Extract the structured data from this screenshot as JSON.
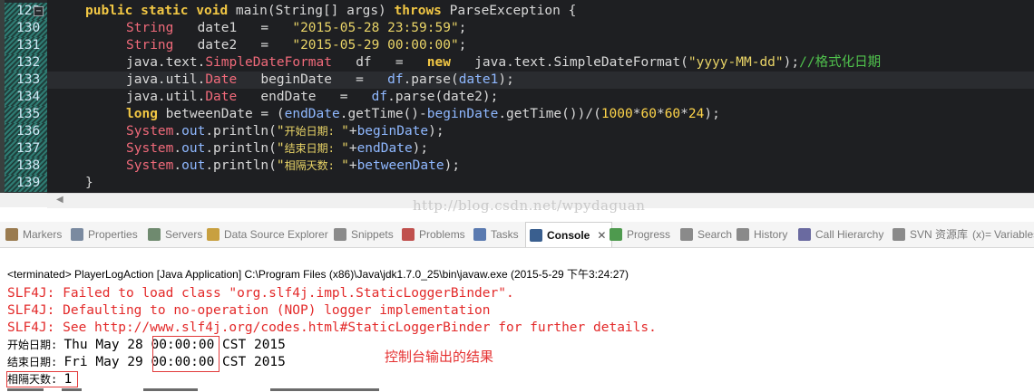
{
  "editor": {
    "line_numbers": [
      "129",
      "130",
      "131",
      "132",
      "133",
      "134",
      "135",
      "136",
      "137",
      "138",
      "139"
    ],
    "lines": [
      [
        [
          "kw",
          "public"
        ],
        [
          "p",
          " "
        ],
        [
          "kw",
          "static"
        ],
        [
          "p",
          " "
        ],
        [
          "kw",
          "void"
        ],
        [
          "p",
          " main("
        ],
        [
          "p",
          "String"
        ],
        [
          "p",
          "[] args) "
        ],
        [
          "kw",
          "throws"
        ],
        [
          "p",
          " ParseException {"
        ]
      ],
      [
        [
          "ty",
          "String"
        ],
        [
          "p",
          "   date1   =   "
        ],
        [
          "str",
          "\"2015-05-28 23:59:59\""
        ],
        [
          "p",
          ";"
        ]
      ],
      [
        [
          "ty",
          "String"
        ],
        [
          "p",
          "   date2   =   "
        ],
        [
          "str",
          "\"2015-05-29 00:00:00\""
        ],
        [
          "p",
          ";"
        ]
      ],
      [
        [
          "p",
          "java.text."
        ],
        [
          "ty",
          "SimpleDateFormat"
        ],
        [
          "p",
          "   df   =   "
        ],
        [
          "kw",
          "new"
        ],
        [
          "p",
          "   java.text.SimpleDateFormat("
        ],
        [
          "str",
          "\"yyyy-MM-dd\""
        ],
        [
          "p",
          ");"
        ],
        [
          "cmt",
          "//格式化日期"
        ]
      ],
      [
        [
          "p",
          "java.util."
        ],
        [
          "ty",
          "Date"
        ],
        [
          "p",
          "   beginDate   =   "
        ],
        [
          "fld",
          "df"
        ],
        [
          "p",
          ".parse("
        ],
        [
          "fld",
          "date1"
        ],
        [
          "p",
          ");"
        ]
      ],
      [
        [
          "p",
          "java.util."
        ],
        [
          "ty",
          "Date"
        ],
        [
          "p",
          "   endDate   =   "
        ],
        [
          "fld",
          "df"
        ],
        [
          "p",
          ".parse(date2);"
        ]
      ],
      [
        [
          "kw",
          "long"
        ],
        [
          "p",
          " betweenDate = ("
        ],
        [
          "fld",
          "endDate"
        ],
        [
          "p",
          ".getTime()-"
        ],
        [
          "fld",
          "beginDate"
        ],
        [
          "p",
          ".getTime())/("
        ],
        [
          "num",
          "1000"
        ],
        [
          "p",
          "*"
        ],
        [
          "num",
          "60"
        ],
        [
          "p",
          "*"
        ],
        [
          "num",
          "60"
        ],
        [
          "p",
          "*"
        ],
        [
          "num",
          "24"
        ],
        [
          "p",
          ");"
        ]
      ],
      [
        [
          "ty",
          "System"
        ],
        [
          "p",
          "."
        ],
        [
          "fld",
          "out"
        ],
        [
          "p",
          ".println("
        ],
        [
          "str",
          "\""
        ],
        [
          "strcjk",
          "开始日期: "
        ],
        [
          "str",
          "\""
        ],
        [
          "p",
          "+"
        ],
        [
          "fld",
          "beginDate"
        ],
        [
          "p",
          ");"
        ]
      ],
      [
        [
          "ty",
          "System"
        ],
        [
          "p",
          "."
        ],
        [
          "fld",
          "out"
        ],
        [
          "p",
          ".println("
        ],
        [
          "str",
          "\""
        ],
        [
          "strcjk",
          "结束日期: "
        ],
        [
          "str",
          "\""
        ],
        [
          "p",
          "+"
        ],
        [
          "fld",
          "endDate"
        ],
        [
          "p",
          ");"
        ]
      ],
      [
        [
          "ty",
          "System"
        ],
        [
          "p",
          "."
        ],
        [
          "fld",
          "out"
        ],
        [
          "p",
          ".println("
        ],
        [
          "str",
          "\""
        ],
        [
          "strcjk",
          "相隔天数: "
        ],
        [
          "str",
          "\""
        ],
        [
          "p",
          "+"
        ],
        [
          "fld",
          "betweenDate"
        ],
        [
          "p",
          ");"
        ]
      ],
      [
        [
          "p",
          "}"
        ]
      ]
    ],
    "indent_levels": [
      0,
      1,
      1,
      1,
      1,
      1,
      1,
      1,
      1,
      1,
      0
    ],
    "current_line_index": 4,
    "watermark": "http://blog.csdn.net/wpydaguan"
  },
  "tabs": [
    {
      "label": "Markers",
      "icon": "markers-icon",
      "color": "#9a7b4f"
    },
    {
      "label": "Properties",
      "icon": "properties-icon",
      "color": "#7a8aa0"
    },
    {
      "label": "Servers",
      "icon": "servers-icon",
      "color": "#6f8a6f"
    },
    {
      "label": "Data Source Explorer",
      "icon": "data-source-icon",
      "color": "#c8a040"
    },
    {
      "label": "Snippets",
      "icon": "snippets-icon",
      "color": "#8a8a8a"
    },
    {
      "label": "Problems",
      "icon": "problems-icon",
      "color": "#c0504d"
    },
    {
      "label": "Tasks",
      "icon": "tasks-icon",
      "color": "#5a7ab0"
    },
    {
      "label": "Console",
      "icon": "console-icon",
      "color": "#3a5f8f",
      "active": true
    },
    {
      "label": "Progress",
      "icon": "progress-icon",
      "color": "#4e9a4e"
    },
    {
      "label": "Search",
      "icon": "search-icon",
      "color": "#8a8a8a"
    },
    {
      "label": "History",
      "icon": "history-icon",
      "color": "#8a8a8a"
    },
    {
      "label": "Call Hierarchy",
      "icon": "call-hierarchy-icon",
      "color": "#6a6aa0"
    },
    {
      "label": "SVN 资源库",
      "icon": "svn-icon",
      "color": "#8a8a8a"
    },
    {
      "label": "Variables",
      "icon": "variables-icon",
      "color": "#8a8a8a",
      "prefix": "(x)="
    }
  ],
  "console": {
    "terminated": "<terminated> PlayerLogAction [Java Application] C:\\Program Files (x86)\\Java\\jdk1.7.0_25\\bin\\javaw.exe (2015-5-29 下午3:24:27)",
    "err_lines": [
      "SLF4J: Failed to load class \"org.slf4j.impl.StaticLoggerBinder\".",
      "SLF4J: Defaulting to no-operation (NOP) logger implementation",
      "SLF4J: See http://www.slf4j.org/codes.html#StaticLoggerBinder for further details."
    ],
    "out_lines": [
      {
        "label": "开始日期: ",
        "value": "Thu May 28 00:00:00 CST 2015"
      },
      {
        "label": "结束日期: ",
        "value": "Fri May 29 00:00:00 CST 2015"
      },
      {
        "label": "相隔天数: ",
        "value": "1"
      }
    ],
    "annotation": "控制台输出的结果"
  }
}
